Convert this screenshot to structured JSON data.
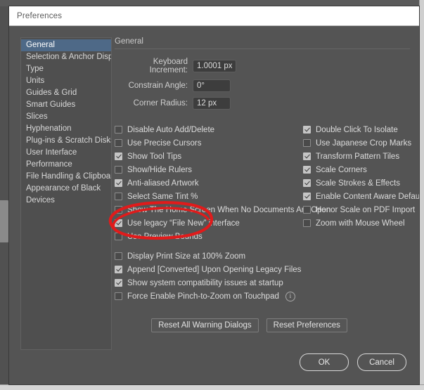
{
  "window": {
    "title": "Preferences"
  },
  "sidebar": {
    "items": [
      {
        "label": "General",
        "selected": true
      },
      {
        "label": "Selection & Anchor Display",
        "selected": false
      },
      {
        "label": "Type",
        "selected": false
      },
      {
        "label": "Units",
        "selected": false
      },
      {
        "label": "Guides & Grid",
        "selected": false
      },
      {
        "label": "Smart Guides",
        "selected": false
      },
      {
        "label": "Slices",
        "selected": false
      },
      {
        "label": "Hyphenation",
        "selected": false
      },
      {
        "label": "Plug-ins & Scratch Disks",
        "selected": false
      },
      {
        "label": "User Interface",
        "selected": false
      },
      {
        "label": "Performance",
        "selected": false
      },
      {
        "label": "File Handling & Clipboard",
        "selected": false
      },
      {
        "label": "Appearance of Black",
        "selected": false
      },
      {
        "label": "Devices",
        "selected": false
      }
    ]
  },
  "main": {
    "section_title": "General",
    "fields": [
      {
        "label": "Keyboard Increment:",
        "value": "1.0001 px",
        "size": "lg"
      },
      {
        "label": "Constrain Angle:",
        "value": "0°",
        "size": "sm"
      },
      {
        "label": "Corner Radius:",
        "value": "12 px",
        "size": "sm"
      }
    ],
    "checkboxes_left": [
      {
        "label": "Disable Auto Add/Delete",
        "checked": false
      },
      {
        "label": "Use Precise Cursors",
        "checked": false
      },
      {
        "label": "Show Tool Tips",
        "checked": true
      },
      {
        "label": "Show/Hide Rulers",
        "checked": false
      },
      {
        "label": "Anti-aliased Artwork",
        "checked": true
      },
      {
        "label": "Select Same Tint %",
        "checked": false
      },
      {
        "label": "Show The Home Screen When No Documents Are Open",
        "checked": false
      },
      {
        "label": "Use legacy “File New” interface",
        "checked": true
      },
      {
        "label": "Use Preview Bounds",
        "checked": false
      }
    ],
    "checkboxes_right": [
      {
        "label": "Double Click To Isolate",
        "checked": true
      },
      {
        "label": "Use Japanese Crop Marks",
        "checked": false
      },
      {
        "label": "Transform Pattern Tiles",
        "checked": true
      },
      {
        "label": "Scale Corners",
        "checked": true
      },
      {
        "label": "Scale Strokes & Effects",
        "checked": true
      },
      {
        "label": "Enable Content Aware Defaults",
        "checked": true
      },
      {
        "label": "Honor Scale on PDF Import",
        "checked": false
      },
      {
        "label": "Zoom with Mouse Wheel",
        "checked": false
      }
    ],
    "checkboxes_extra": [
      {
        "label": "Display Print Size at 100% Zoom",
        "checked": false,
        "info": false
      },
      {
        "label": "Append [Converted] Upon Opening Legacy Files",
        "checked": true,
        "info": false
      },
      {
        "label": "Show system compatibility issues at startup",
        "checked": true,
        "info": false
      },
      {
        "label": "Force Enable Pinch-to-Zoom on Touchpad",
        "checked": false,
        "info": true
      }
    ],
    "info_icon_glyph": "i",
    "reset_buttons": [
      {
        "label": "Reset All Warning Dialogs"
      },
      {
        "label": "Reset Preferences"
      }
    ]
  },
  "footer": {
    "ok_label": "OK",
    "cancel_label": "Cancel"
  },
  "annotation": {
    "type": "hand-drawn-ellipse",
    "color": "#e01b1b",
    "targets": "Use legacy “File New” interface"
  },
  "colors": {
    "dialog_bg": "#545454",
    "titlebar_bg": "#ffffff",
    "selected_item_bg": "#4e6987",
    "annotation_red": "#e01b1b",
    "text": "#dcdcdc"
  }
}
